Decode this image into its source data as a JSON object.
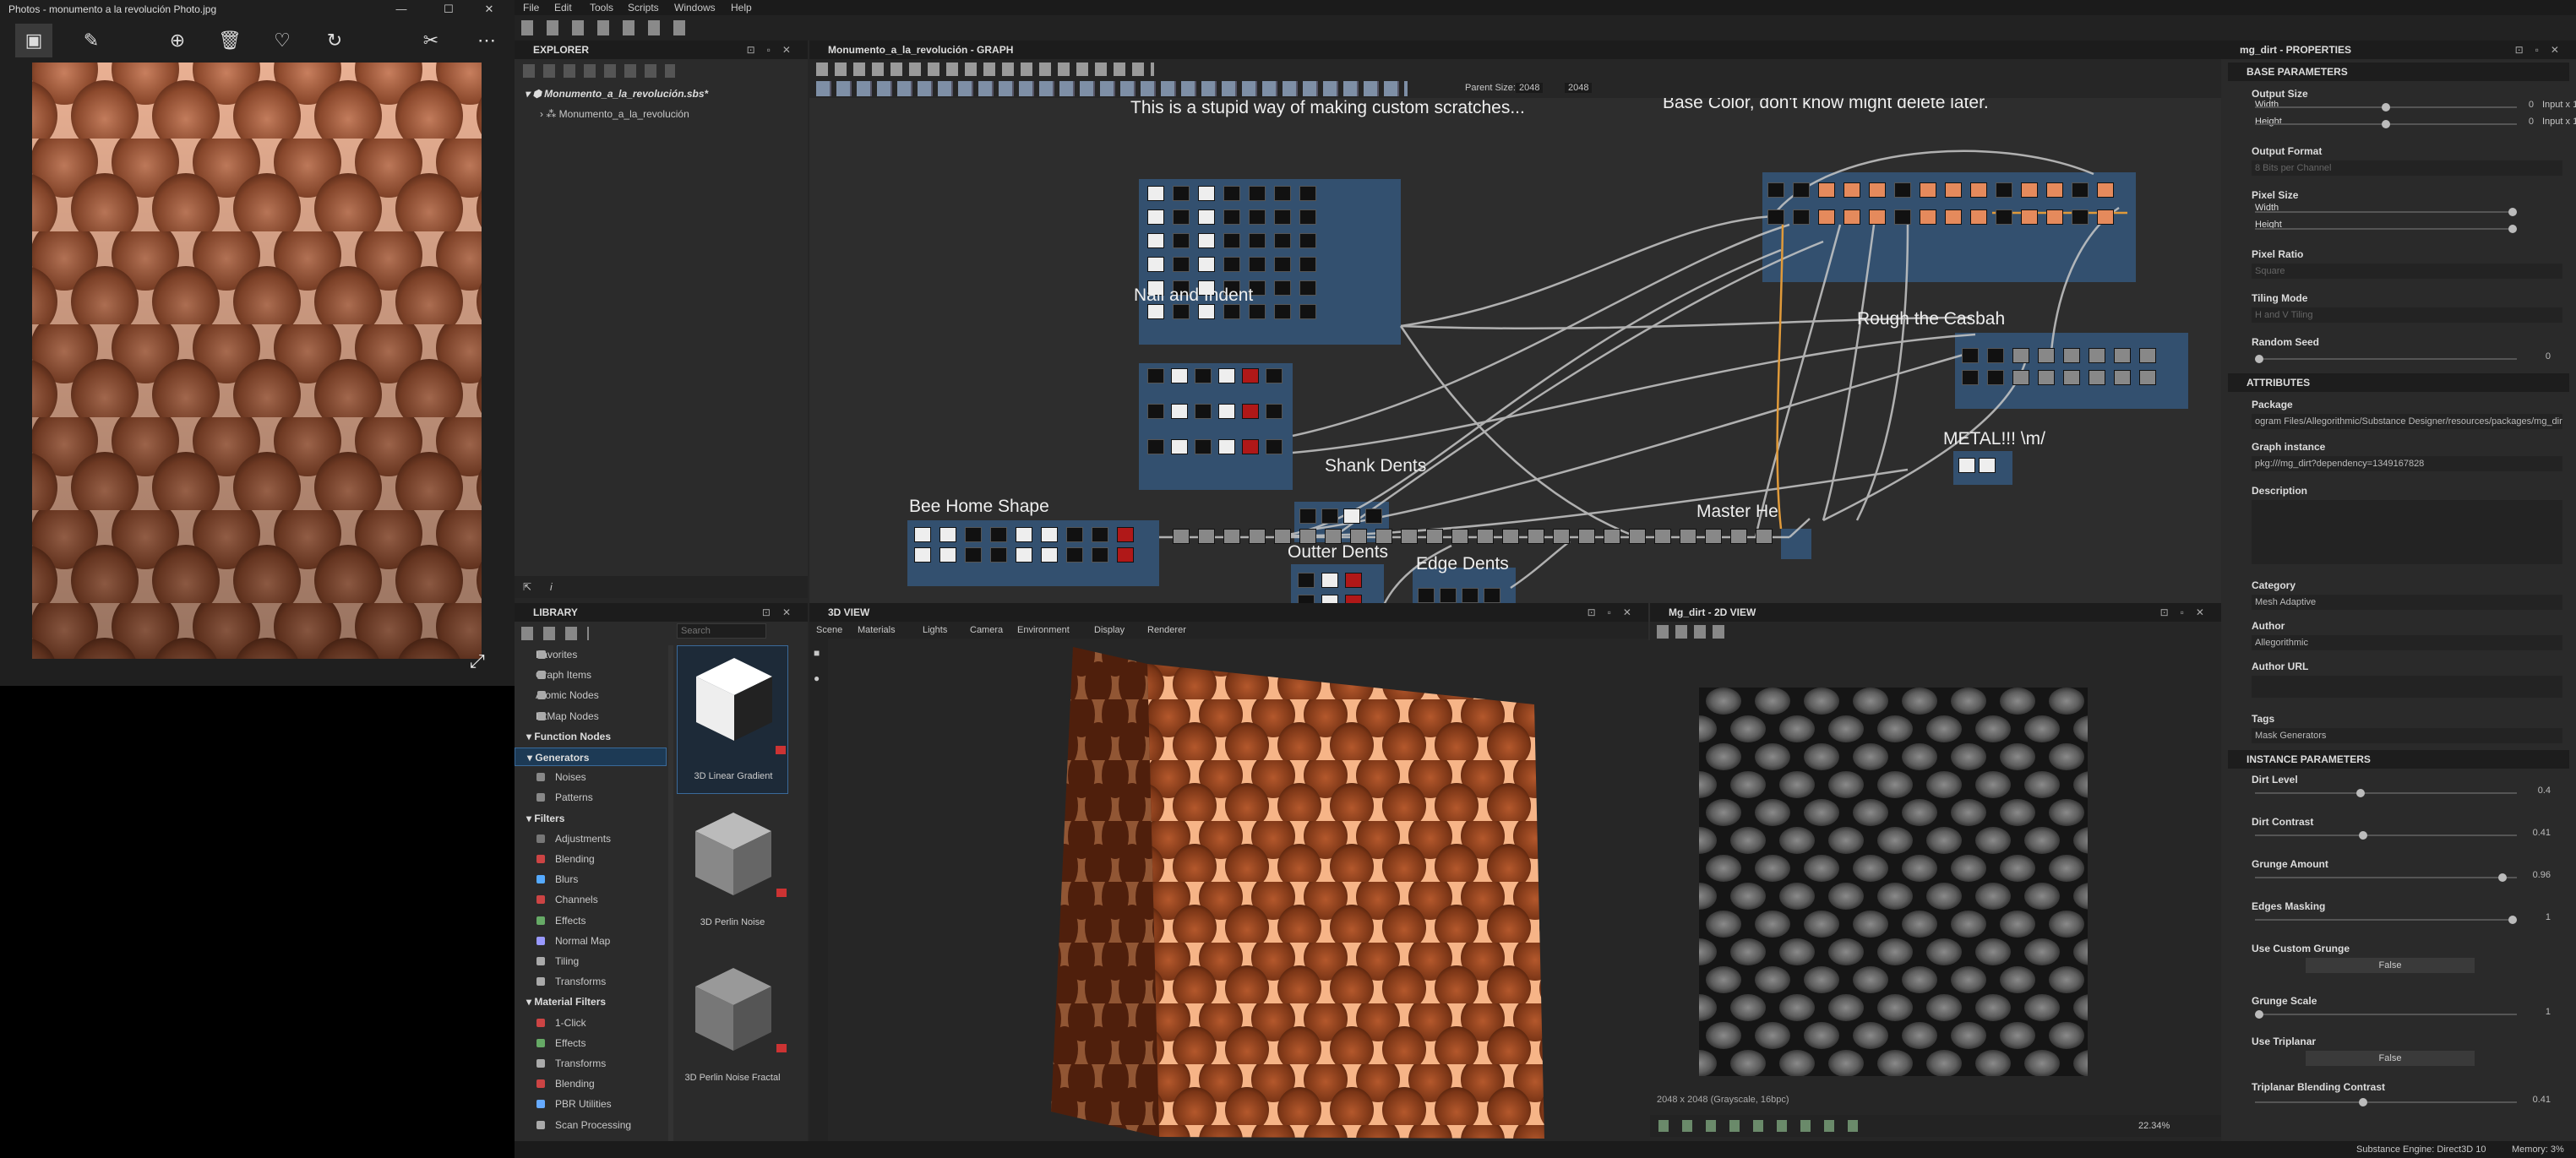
{
  "photos": {
    "title": "Photos - monumento a la revolución Photo.jpg",
    "window_controls": {
      "minimize": "—",
      "maximize": "☐",
      "close": "✕"
    },
    "toolbar": {
      "view": "▣",
      "edit": "✎",
      "zoom": "⊕",
      "delete": "🗑",
      "favorite": "♡",
      "rotate": "↻",
      "crop": "✂",
      "more": "⋯"
    },
    "expand": "⤢"
  },
  "menu": [
    "File",
    "Edit",
    "Tools",
    "Scripts",
    "Windows",
    "Help"
  ],
  "explorer": {
    "title": "EXPLORER",
    "package": "Monumento_a_la_revolución.sbs*",
    "graph": "Monumento_a_la_revolución"
  },
  "graph": {
    "title": "Monumento_a_la_revolución - GRAPH",
    "parent_size_label": "Parent Size:",
    "parent_size_w": "2048",
    "parent_size_h": "2048",
    "frames": {
      "scratches": "This is a stupid way of making custom scratches...",
      "nail": "Nail and Indent",
      "bee": "Bee Home Shape",
      "shank": "Shank Dents",
      "outter": "Outter Dents",
      "edge": "Edge Dents",
      "master": "Master He",
      "base": "Base Color, don't know might delete later.",
      "rough": "Rough the Casbah",
      "metal": "METAL!!! \\m/"
    }
  },
  "library": {
    "title": "LIBRARY",
    "search_placeholder": "Search",
    "items": [
      {
        "label": "Favorites",
        "kind": "item"
      },
      {
        "label": "Graph Items",
        "kind": "item"
      },
      {
        "label": "Atomic Nodes",
        "kind": "item"
      },
      {
        "label": "FxMap Nodes",
        "kind": "item"
      },
      {
        "label": "Function Nodes",
        "kind": "section"
      },
      {
        "label": "Generators",
        "kind": "section"
      },
      {
        "label": "Noises",
        "kind": "sub"
      },
      {
        "label": "Patterns",
        "kind": "sub"
      },
      {
        "label": "Filters",
        "kind": "section"
      },
      {
        "label": "Adjustments",
        "kind": "sub"
      },
      {
        "label": "Blending",
        "kind": "sub"
      },
      {
        "label": "Blurs",
        "kind": "sub"
      },
      {
        "label": "Channels",
        "kind": "sub"
      },
      {
        "label": "Effects",
        "kind": "sub"
      },
      {
        "label": "Normal Map",
        "kind": "sub"
      },
      {
        "label": "Tiling",
        "kind": "sub"
      },
      {
        "label": "Transforms",
        "kind": "sub"
      },
      {
        "label": "Material Filters",
        "kind": "section"
      },
      {
        "label": "1-Click",
        "kind": "sub"
      },
      {
        "label": "Effects",
        "kind": "sub"
      },
      {
        "label": "Transforms",
        "kind": "sub"
      },
      {
        "label": "Blending",
        "kind": "sub"
      },
      {
        "label": "PBR Utilities",
        "kind": "sub"
      },
      {
        "label": "Scan Processing",
        "kind": "sub"
      }
    ],
    "thumbs": [
      "3D Linear Gradient",
      "3D Perlin Noise",
      "3D Perlin Noise Fractal"
    ]
  },
  "view3d": {
    "title": "3D VIEW",
    "menu": [
      "Scene",
      "Materials",
      "Lights",
      "Camera",
      "Environment",
      "Display",
      "Renderer"
    ]
  },
  "view2d": {
    "title": "Mg_dirt - 2D VIEW",
    "info": "2048 x 2048 (Grayscale, 16bpc)",
    "zoom": "22.34%"
  },
  "properties": {
    "title": "mg_dirt - PROPERTIES",
    "base_title": "BASE PARAMETERS",
    "output_size": "Output Size",
    "width": "Width",
    "height": "Height",
    "w_val": "0",
    "h_val": "0",
    "w_mode": "Input x 1",
    "h_mode": "Input x 1",
    "output_format": "Output Format",
    "output_format_val": "8 Bits per Channel",
    "pixel_size": "Pixel Size",
    "pixel_ratio": "Pixel Ratio",
    "pixel_ratio_val": "Square",
    "tiling_mode": "Tiling Mode",
    "tiling_mode_val": "H and V Tiling",
    "random_seed": "Random Seed",
    "random_seed_val": "0",
    "attr_title": "ATTRIBUTES",
    "package": "Package",
    "package_val": "ogram Files/Allegorithmic/Substance Designer/resources/packages/mg_dirt.sbs",
    "graph_instance": "Graph instance",
    "graph_instance_val": "pkg:///mg_dirt?dependency=1349167828",
    "description": "Description",
    "category": "Category",
    "category_val": "Mesh Adaptive",
    "author": "Author",
    "author_val": "Allegorithmic",
    "author_url": "Author URL",
    "tags": "Tags",
    "tags_val": "Mask Generators",
    "inst_title": "INSTANCE PARAMETERS",
    "params": [
      {
        "label": "Dirt Level",
        "value": "0.4",
        "pos": 0.4
      },
      {
        "label": "Dirt Contrast",
        "value": "0.41",
        "pos": 0.41
      },
      {
        "label": "Grunge Amount",
        "value": "0.96",
        "pos": 0.96
      },
      {
        "label": "Edges Masking",
        "value": "1",
        "pos": 1
      },
      {
        "label": "Grunge Scale",
        "value": "1",
        "pos": 0
      }
    ],
    "use_custom_grunge": "Use Custom Grunge",
    "false_label": "False",
    "use_triplanar": "Use Triplanar",
    "triplanar_blend": "Triplanar Blending Contrast",
    "triplanar_val": "0.41",
    "triplanar_pos": 0.41
  },
  "status": {
    "engine": "Substance Engine: Direct3D 10",
    "memory": "Memory: 3%"
  }
}
